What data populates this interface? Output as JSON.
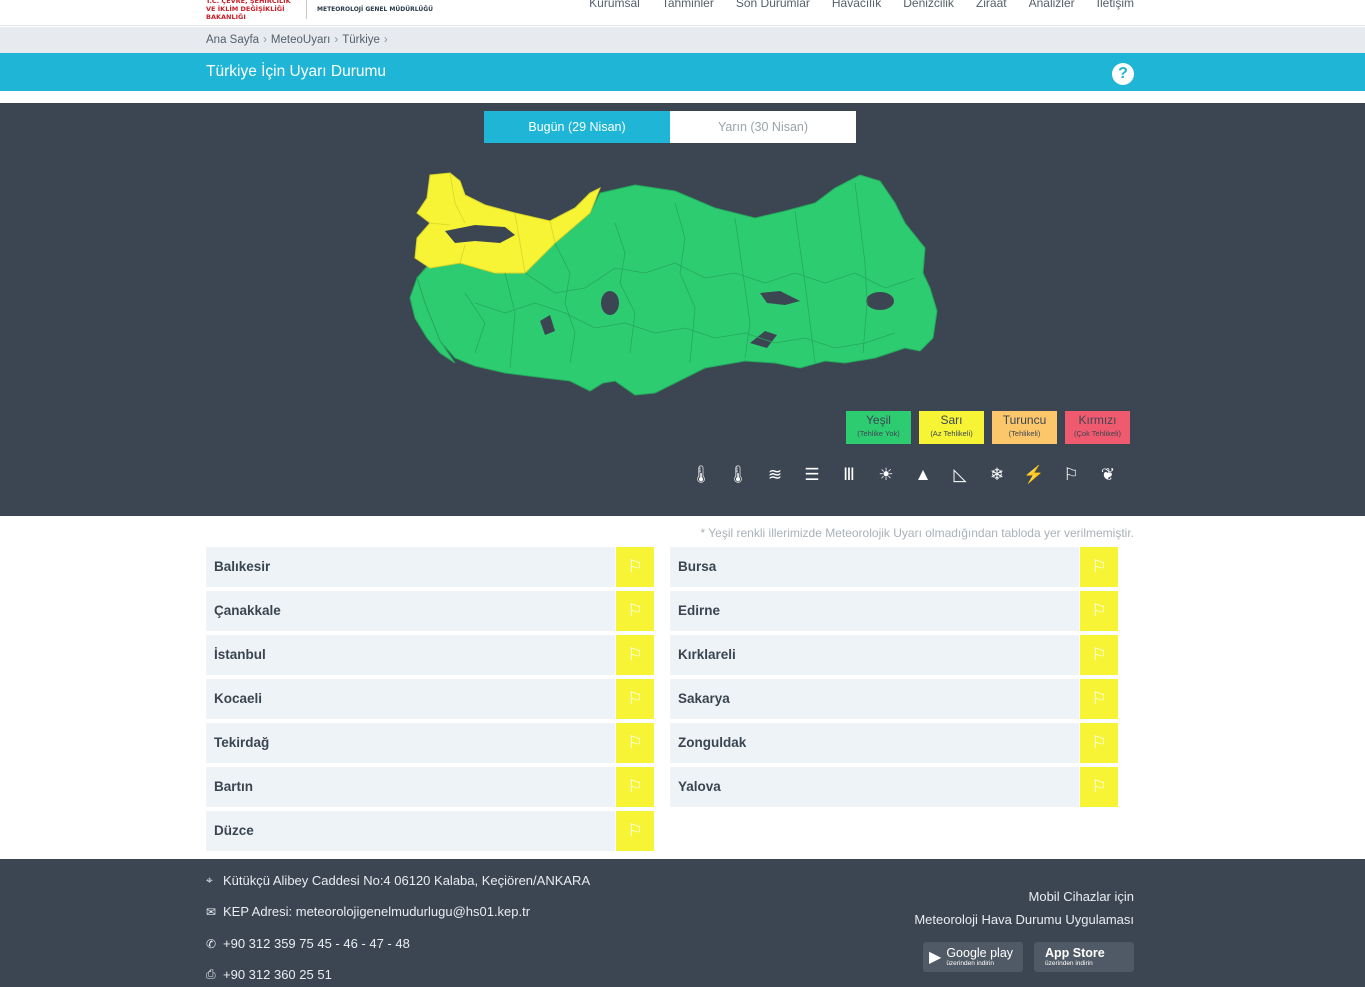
{
  "header": {
    "logo_ministry": "T.C. ÇEVRE, ŞEHİRCİLİK VE İKLİM DEĞİŞİKLİĞİ BAKANLIĞI",
    "logo_mgm": "METEOROLOJİ GENEL MÜDÜRLÜĞÜ",
    "nav": [
      "Kurumsal",
      "Tahminler",
      "Son Durumlar",
      "Havacılık",
      "Denizcilik",
      "Ziraat",
      "Analizler",
      "İletişim"
    ]
  },
  "breadcrumb": [
    "Ana Sayfa",
    "MeteoUyarı",
    "Türkiye"
  ],
  "page_title": "Türkiye İçin Uyarı Durumu",
  "help_icon": "question-circle-icon",
  "tabs": [
    {
      "label": "Bugün (29 Nisan)",
      "active": true
    },
    {
      "label": "Yarın (30 Nisan)",
      "active": false
    }
  ],
  "legend": [
    {
      "name": "Yeşil",
      "desc": "(Tehlike Yok)",
      "color": "#2ecc71"
    },
    {
      "name": "Sarı",
      "desc": "(Az Tehlikeli)",
      "color": "#f6f435"
    },
    {
      "name": "Turuncu",
      "desc": "(Tehlikeli)",
      "color": "#fbc76a"
    },
    {
      "name": "Kırmızı",
      "desc": "(Çok Tehlikeli)",
      "color": "#f05a6e"
    }
  ],
  "hazard_icons": [
    "cold-icon",
    "hot-icon",
    "fog-icon",
    "dust-icon",
    "wind-icon",
    "snow-melt-icon",
    "avalanche-icon",
    "agricultural-frost-icon",
    "snowflake-icon",
    "thunderstorm-icon",
    "windsock-icon",
    "rain-icon"
  ],
  "note": "* Yeşil renkli illerimizde Meteorolojik Uyarı olmadığından tabloda yer verilmemiştir.",
  "warnings_left": [
    "Balıkesir",
    "Çanakkale",
    "İstanbul",
    "Kocaeli",
    "Tekirdağ",
    "Bartın",
    "Düzce"
  ],
  "warnings_right": [
    "Bursa",
    "Edirne",
    "Kırklareli",
    "Sakarya",
    "Zonguldak",
    "Yalova"
  ],
  "warning_icon": "windsock-icon",
  "warning_color": "#f6f435",
  "footer": {
    "address": "Kütükçü Alibey Caddesi No:4 06120 Kalaba, Keçiören/ANKARA",
    "kep": "KEP Adresi: meteorolojigenelmudurlugu@hs01.kep.tr",
    "phone": "+90 312 359 75 45 - 46 - 47 - 48",
    "fax": "+90 312 360 25 51",
    "mobile_line1": "Mobil Cihazlar için",
    "mobile_line2": "Meteoroloji Hava Durumu Uygulaması",
    "google_play": "Google play",
    "google_play_sub": "üzerinden indirin",
    "app_store": "App Store",
    "app_store_sub": "üzerinden indirin"
  }
}
